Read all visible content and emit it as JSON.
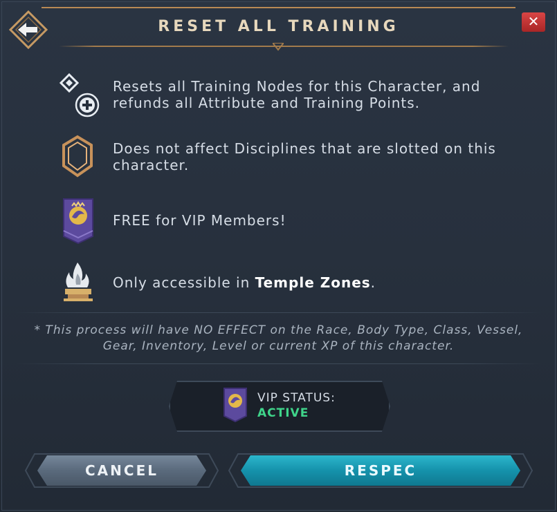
{
  "dialog": {
    "title": "RESET ALL TRAINING",
    "close_label": "✕"
  },
  "items": [
    {
      "icon": "training-nodes-icon",
      "text": "Resets all Training Nodes for this Character, and refunds all Attribute and Training Points."
    },
    {
      "icon": "discipline-hexagon-icon",
      "text": "Does not affect Disciplines that are slotted on this character."
    },
    {
      "icon": "vip-banner-icon",
      "text": "FREE for VIP Members!"
    },
    {
      "icon": "temple-flame-icon",
      "text_prefix": "Only accessible in ",
      "text_bold": "Temple Zones",
      "text_suffix": "."
    }
  ],
  "note": "* This process will have NO EFFECT on the Race, Body Type, Class, Vessel, Gear, Inventory, Level or current XP of this character.",
  "vip": {
    "label": "VIP STATUS:",
    "value": "ACTIVE",
    "value_color": "#3fd48a"
  },
  "buttons": {
    "cancel": "CANCEL",
    "respec": "RESPEC"
  },
  "colors": {
    "accent_gold": "#b88954",
    "respec_teal": "#1592ab",
    "close_red": "#c93434"
  }
}
